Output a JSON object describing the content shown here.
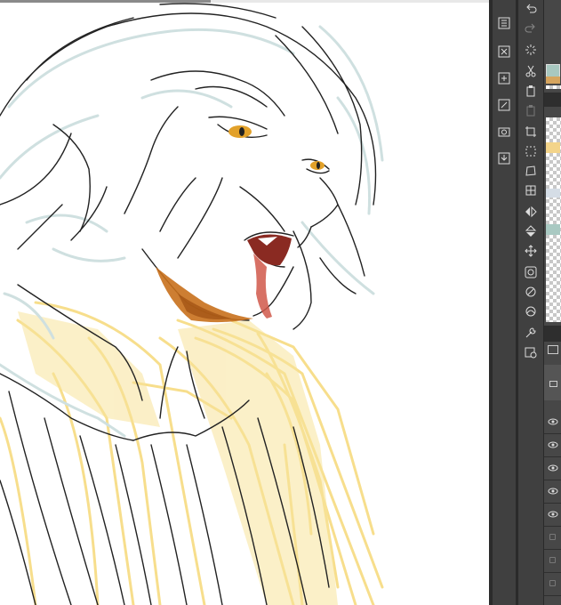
{
  "app": {
    "canvas_background": "#ffffff",
    "panel_background": "#404040",
    "accent_yellow": "#f5d66a",
    "accent_orange": "#c8701c"
  },
  "canvas": {
    "description_visible": "",
    "progress_fraction": 0.43
  },
  "command_bar": {
    "tools": [
      {
        "icon": "undo-icon"
      },
      {
        "icon": "redo-icon"
      },
      {
        "icon": "loading-spinner-icon"
      },
      {
        "icon": "cut-icon"
      },
      {
        "icon": "copy-icon"
      },
      {
        "icon": "paste-icon"
      },
      {
        "icon": "crop-icon"
      },
      {
        "icon": "select-rectangle-icon"
      },
      {
        "icon": "transform-icon"
      },
      {
        "icon": "mesh-transform-icon"
      },
      {
        "icon": "flip-horizontal-icon"
      },
      {
        "icon": "flip-vertical-icon"
      },
      {
        "icon": "move-icon"
      },
      {
        "icon": "layer-property-icon"
      },
      {
        "icon": "ruler-icon"
      },
      {
        "icon": "snap-icon"
      },
      {
        "icon": "settings-wrench-icon"
      },
      {
        "icon": "camera-settings-icon"
      }
    ]
  },
  "file_bar": {
    "tools": [
      {
        "icon": "new-page-icon"
      },
      {
        "icon": "close-file-icon"
      },
      {
        "icon": "save-file-icon"
      },
      {
        "icon": "edit-file-icon"
      },
      {
        "icon": "screenshot-icon"
      },
      {
        "icon": "import-icon"
      }
    ]
  },
  "layers": {
    "swatch_colors": [
      "#a8c8c0",
      "#d6a55e",
      "#f3d48a",
      "#d5dde6",
      "#a9c9c2"
    ],
    "visible_rows": 9
  }
}
